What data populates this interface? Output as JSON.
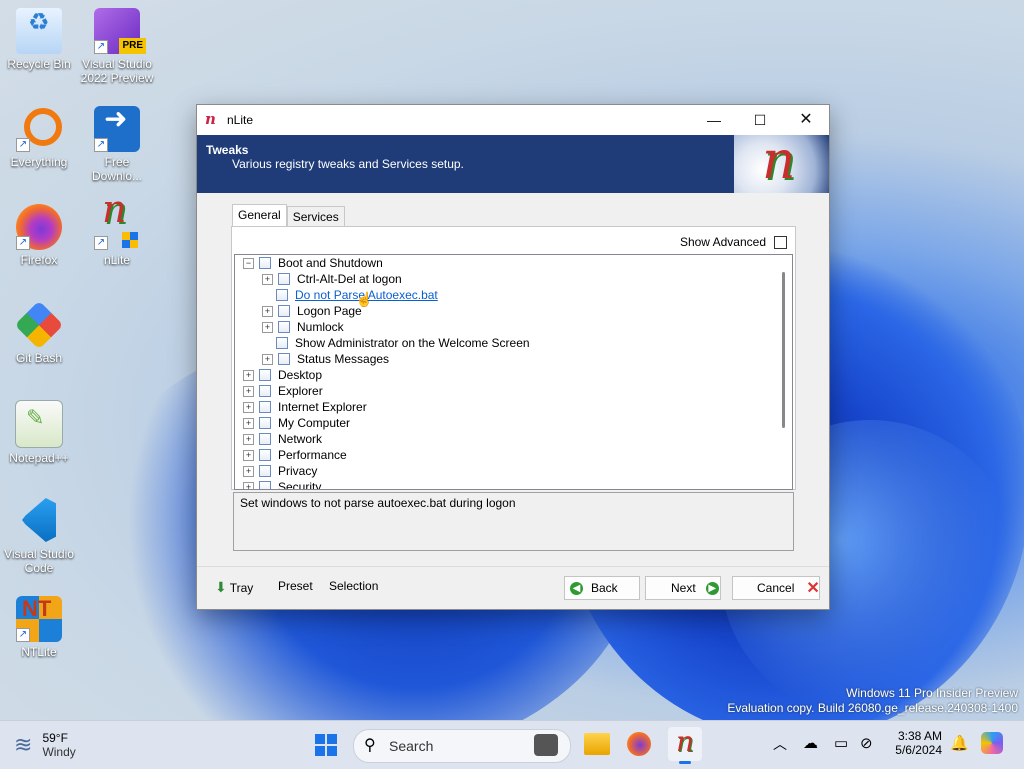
{
  "desktop_icons": [
    {
      "label": "Recycle Bin",
      "icon": "recycle-bin-icon"
    },
    {
      "label": "Visual Studio 2022 Preview",
      "icon": "visual-studio-icon",
      "badge": "PRE"
    },
    {
      "label": "Everything",
      "icon": "everything-icon"
    },
    {
      "label": "Free Downlo...",
      "icon": "free-download-icon"
    },
    {
      "label": "Firefox",
      "icon": "firefox-icon"
    },
    {
      "label": "nLite",
      "icon": "nlite-icon"
    },
    {
      "label": "Git Bash",
      "icon": "git-bash-icon"
    },
    {
      "label": "Notepad++",
      "icon": "notepadpp-icon"
    },
    {
      "label": "Visual Studio Code",
      "icon": "vscode-icon"
    },
    {
      "label": "NTLite",
      "icon": "ntlite-icon"
    }
  ],
  "window": {
    "title": "nLite",
    "banner": {
      "heading": "Tweaks",
      "subtitle": "Various registry tweaks and Services setup."
    },
    "tabs": [
      "General",
      "Services"
    ],
    "show_advanced_label": "Show Advanced",
    "tree": [
      {
        "label": "Boot and Shutdown",
        "children": [
          {
            "label": "Ctrl-Alt-Del at logon"
          },
          {
            "label": "Do not Parse Autoexec.bat",
            "selected": true
          },
          {
            "label": "Logon Page"
          },
          {
            "label": "Numlock"
          },
          {
            "label": "Show Administrator on the Welcome Screen"
          },
          {
            "label": "Status Messages"
          }
        ]
      },
      {
        "label": "Desktop"
      },
      {
        "label": "Explorer"
      },
      {
        "label": "Internet Explorer"
      },
      {
        "label": "My Computer"
      },
      {
        "label": "Network"
      },
      {
        "label": "Performance"
      },
      {
        "label": "Privacy"
      },
      {
        "label": "Security"
      }
    ],
    "description": "Set windows to not parse autoexec.bat during logon",
    "footer": {
      "tray": "Tray",
      "preset": "Preset",
      "selection": "Selection",
      "back": "Back",
      "next": "Next",
      "cancel": "Cancel"
    }
  },
  "watermark": {
    "line1": "Windows 11 Pro Insider Preview",
    "line2": "Evaluation copy. Build 26080.ge_release.240308-1400"
  },
  "taskbar": {
    "weather_temp": "59°F",
    "weather_desc": "Windy",
    "search_placeholder": "Search",
    "time": "3:38 AM",
    "date": "5/6/2024"
  }
}
